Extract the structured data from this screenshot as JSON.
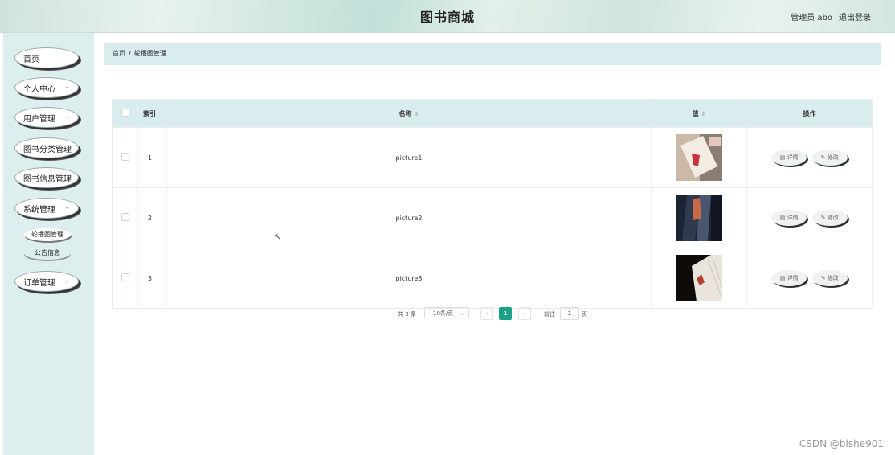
{
  "header": {
    "title": "图书商城",
    "admin_label": "管理员 abo",
    "logout_label": "退出登录"
  },
  "sidebar": {
    "items": [
      {
        "label": "首页",
        "has_chevron": false
      },
      {
        "label": "个人中心",
        "has_chevron": true
      },
      {
        "label": "用户管理",
        "has_chevron": true
      },
      {
        "label": "图书分类管理",
        "has_chevron": false
      },
      {
        "label": "图书信息管理",
        "has_chevron": false
      },
      {
        "label": "系统管理",
        "has_chevron": true
      },
      {
        "label": "订单管理",
        "has_chevron": true
      }
    ],
    "sub_items": [
      {
        "label": "轮播图管理",
        "active": true
      },
      {
        "label": "公告信息",
        "active": false
      }
    ]
  },
  "breadcrumb": {
    "home": "首页",
    "separator": "/",
    "current": "轮播图管理"
  },
  "table": {
    "columns": {
      "index": "索引",
      "name": "名称",
      "value": "值",
      "actions": "操作"
    },
    "rows": [
      {
        "index": "1",
        "name": "picture1"
      },
      {
        "index": "2",
        "name": "picture2"
      },
      {
        "index": "3",
        "name": "picture3"
      }
    ],
    "actions": {
      "detail": "详情",
      "edit": "修改"
    }
  },
  "pagination": {
    "total": "共 3 条",
    "page_size": "10条/页",
    "current_page": "1",
    "goto_label": "前往",
    "goto_value": "1",
    "page_unit": "页"
  },
  "watermark": "CSDN @bishe901",
  "colors": {
    "accent": "#1aa085",
    "header_bg": "#d4e8e2",
    "sidebar_bg": "#dceeed",
    "table_header_bg": "#d9ecee"
  }
}
